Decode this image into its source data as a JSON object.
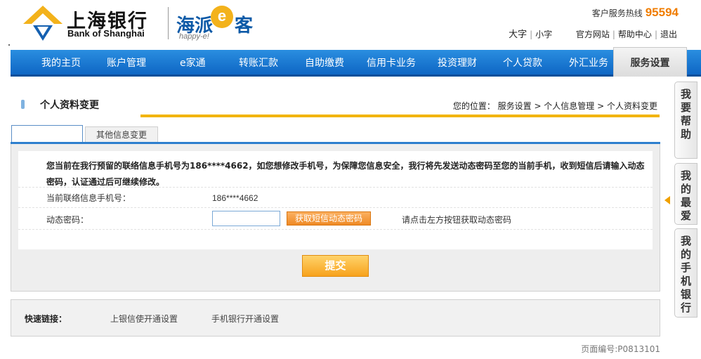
{
  "header": {
    "logo_cn": "上海银行",
    "logo_en": "Bank of Shanghai",
    "brand_main": "海派",
    "brand_e": "e",
    "brand_end": "客",
    "brand_sub": "happy-e!",
    "hotline_label": "客户服务热线",
    "hotline_number": "95594",
    "font_large": "大字",
    "font_small": "小字",
    "links": [
      "官方网站",
      "帮助中心",
      "退出"
    ]
  },
  "nav": {
    "items": [
      "我的主页",
      "账户管理",
      "e家通",
      "转账汇款",
      "自助缴费",
      "信用卡业务",
      "投资理财",
      "个人贷款",
      "外汇业务"
    ],
    "active": "服务设置"
  },
  "page": {
    "title": "个人资料变更",
    "breadcrumb": "您的位置：  服务设置 > 个人信息管理 > 个人资料变更",
    "tabs": [
      "",
      "其他信息变更"
    ]
  },
  "form": {
    "notice": "您当前在我行预留的联络信息手机号为186****4662，如您想修改手机号，为保障您信息安全，我行将先发送动态密码至您的当前手机，收到短信后请输入动态密码，认证通过后可继续修改。",
    "phone_label": "当前联络信息手机号：",
    "phone_value": "186****4662",
    "otp_label": "动态密码：",
    "otp_value": "",
    "otp_button": "获取短信动态密码",
    "otp_tip": "请点击左方按钮获取动态密码",
    "submit": "提交"
  },
  "quick_links": {
    "label": "快速链接：",
    "items": [
      "上银信使开通设置",
      "手机银行开通设置"
    ]
  },
  "page_number": "页面编号:P0813101",
  "float_bar": [
    "我要帮助",
    "我的最爱",
    "我的手机银行"
  ],
  "colors": {
    "nav_blue": "#1a7ad4",
    "accent_orange": "#f39a1f",
    "title_line": "#f2b400",
    "hotline": "#f07d00"
  }
}
